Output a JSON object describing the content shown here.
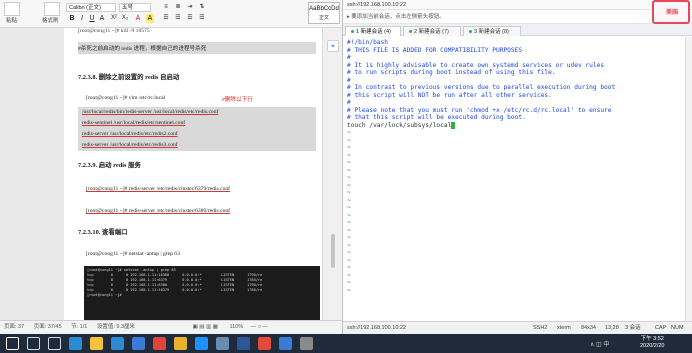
{
  "word": {
    "ribbon": {
      "paste_label": "粘贴",
      "format_painter_label": "格式刷",
      "font_name": "Calibri (正文)",
      "font_size": "五号",
      "style_preview": "AaBbCcDd",
      "style_name": "正文",
      "buttons": [
        "B",
        "I",
        "U",
        "A",
        "X²",
        "X₂",
        "A",
        "A"
      ]
    },
    "doc": {
      "cut_top": "[root@cong11 ~]# kill -9 10575",
      "note": "#杀死之前启动的 redis 进程，根据自己的进程号杀死",
      "h1": "7.2.3.8.    删除之前设置的 redis 自启动",
      "vim_cmd": "[root@cong11 ~]# vim /etc/rc.local",
      "vim_comment": "#删除以下行",
      "hl_lines": [
        "/usr/local/redis/bin/redis-server /usr/local/redis/etc/redis.conf",
        "redis-sentinel /usr/local/redis/etc/sentinel.conf",
        "redis-server /usr/local/redis/etc/redis2.conf",
        "redis-server /usr/local/redis/etc/redis3.conf"
      ],
      "h2": "7.2.3.9.    启动 redis 服务",
      "start1": "[root@cong11 ~]# redis-server /etc/redis/cluster/6379/redis.conf",
      "start2": "[root@cong11 ~]# redis-server /etc/redis/cluster/6380/redis.conf",
      "h3": "7.2.3.10.    查看端口",
      "netstat": "[root@cong11 ~]# netstat -antup | grep 63",
      "term_lines": [
        "[root@cong11 ~]# netstat -antup | grep 63",
        "tcp        0      0 192.168.1.11:16380      0.0.0.0:*         LISTEN      1790/re",
        "tcp        0      0 192.168.1.11:6379       0.0.0.0:*         LISTEN      1788/re",
        "tcp        0      0 192.168.1.11:6380       0.0.0.0:*         LISTEN      1790/re",
        "tcp        0      0 192.168.1.11:16379      0.0.0.0:*         LISTEN      1788/re",
        "[root@cong11 ~]#"
      ]
    },
    "status": {
      "page": "页面: 37",
      "pages": "页面: 37/45",
      "section": "节: 1/1",
      "setting": "设置值: 9.3厘米",
      "zoom": "110%"
    }
  },
  "ssh": {
    "address": "ssh://192.168.100.10:22",
    "hint": "要添加当前会话，点击左侧箭头按钮。",
    "tabs": [
      "1 新建会话 (4)",
      "2 新建会话 (7)",
      "3 新建会话 (8)"
    ],
    "lines": [
      {
        "t": "#!/bin/bash",
        "c": "comment"
      },
      {
        "t": "# THIS FILE IS ADDED FOR COMPATIBILITY PURPOSES",
        "c": "comment"
      },
      {
        "t": "#",
        "c": "comment"
      },
      {
        "t": "# It is highly advisable to create own systemd services or udev rules",
        "c": "comment"
      },
      {
        "t": "# to run scripts during boot instead of using this file.",
        "c": "comment"
      },
      {
        "t": "#",
        "c": "comment"
      },
      {
        "t": "# In contrast to previous versions due to parallel execution during boot",
        "c": "comment"
      },
      {
        "t": "# this script will NOT be run after all other services.",
        "c": "comment"
      },
      {
        "t": "#",
        "c": "comment"
      },
      {
        "t": "# Please note that you must run 'chmod +x /etc/rc.d/rc.local' to ensure",
        "c": "comment"
      },
      {
        "t": "# that this script will be executed during boot.",
        "c": "comment"
      },
      {
        "t": "",
        "c": "cmd"
      },
      {
        "t": "touch /var/lock/subsys/local",
        "c": "cmd"
      }
    ],
    "tilde": "~",
    "status": {
      "addr": "ssh://192.168.100.10:22",
      "proto": "SSH2",
      "term": "xterm",
      "size": "84x34",
      "pos": "13,28",
      "sessions": "3 会话",
      "caps": "CAP",
      "num": "NUM"
    },
    "badge": "美国"
  },
  "taskbar": {
    "time": "下午 3:52",
    "date": "2020/2/20",
    "tray": "∧ ◫ 中",
    "icons": [
      "start",
      "search",
      "task-view",
      "ie",
      "explorer",
      "edge",
      "store",
      "wps",
      "chrome",
      "qq",
      "vmware",
      "word",
      "xshell",
      "mail",
      "calc"
    ]
  }
}
